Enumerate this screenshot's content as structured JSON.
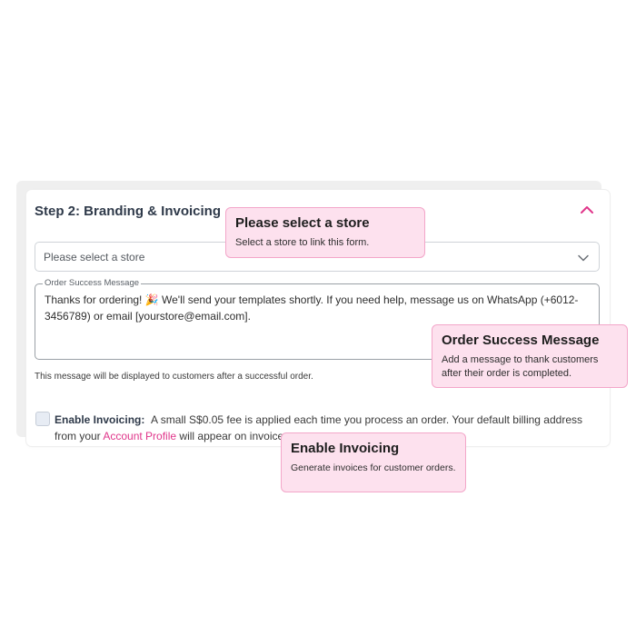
{
  "card": {
    "title": "Step 2: Branding & Invoicing",
    "collapse_icon": "chevron-up-icon",
    "accent_color": "#e0358a"
  },
  "store_select": {
    "placeholder": "Please select a store",
    "icon": "chevron-down-icon"
  },
  "order_message": {
    "label": "Order Success Message",
    "value": "Thanks for ordering! 🎉 We'll send your templates shortly. If you need help, message us on WhatsApp (+6012-3456789) or email [yourstore@email.com].",
    "helper": "This message will be displayed to customers after a successful order."
  },
  "invoicing": {
    "label": "Enable Invoicing:",
    "text_before": "A small S$0.05 fee is applied each time you process an order. Your default billing address from your",
    "link": "Account Profile",
    "text_after": "will appear on invoices.",
    "checked": false
  },
  "tooltips": {
    "store": {
      "title": "Please select a store",
      "body": "Select a store to link this form."
    },
    "order": {
      "title": "Order Success Message",
      "body": "Add a message to thank customers after their order is completed."
    },
    "invoice": {
      "title": "Enable Invoicing",
      "body": "Generate invoices for customer orders."
    }
  },
  "colors": {
    "tooltip_bg": "#fde1ee",
    "tooltip_border": "#f3a6c9",
    "link": "#e0358a"
  }
}
